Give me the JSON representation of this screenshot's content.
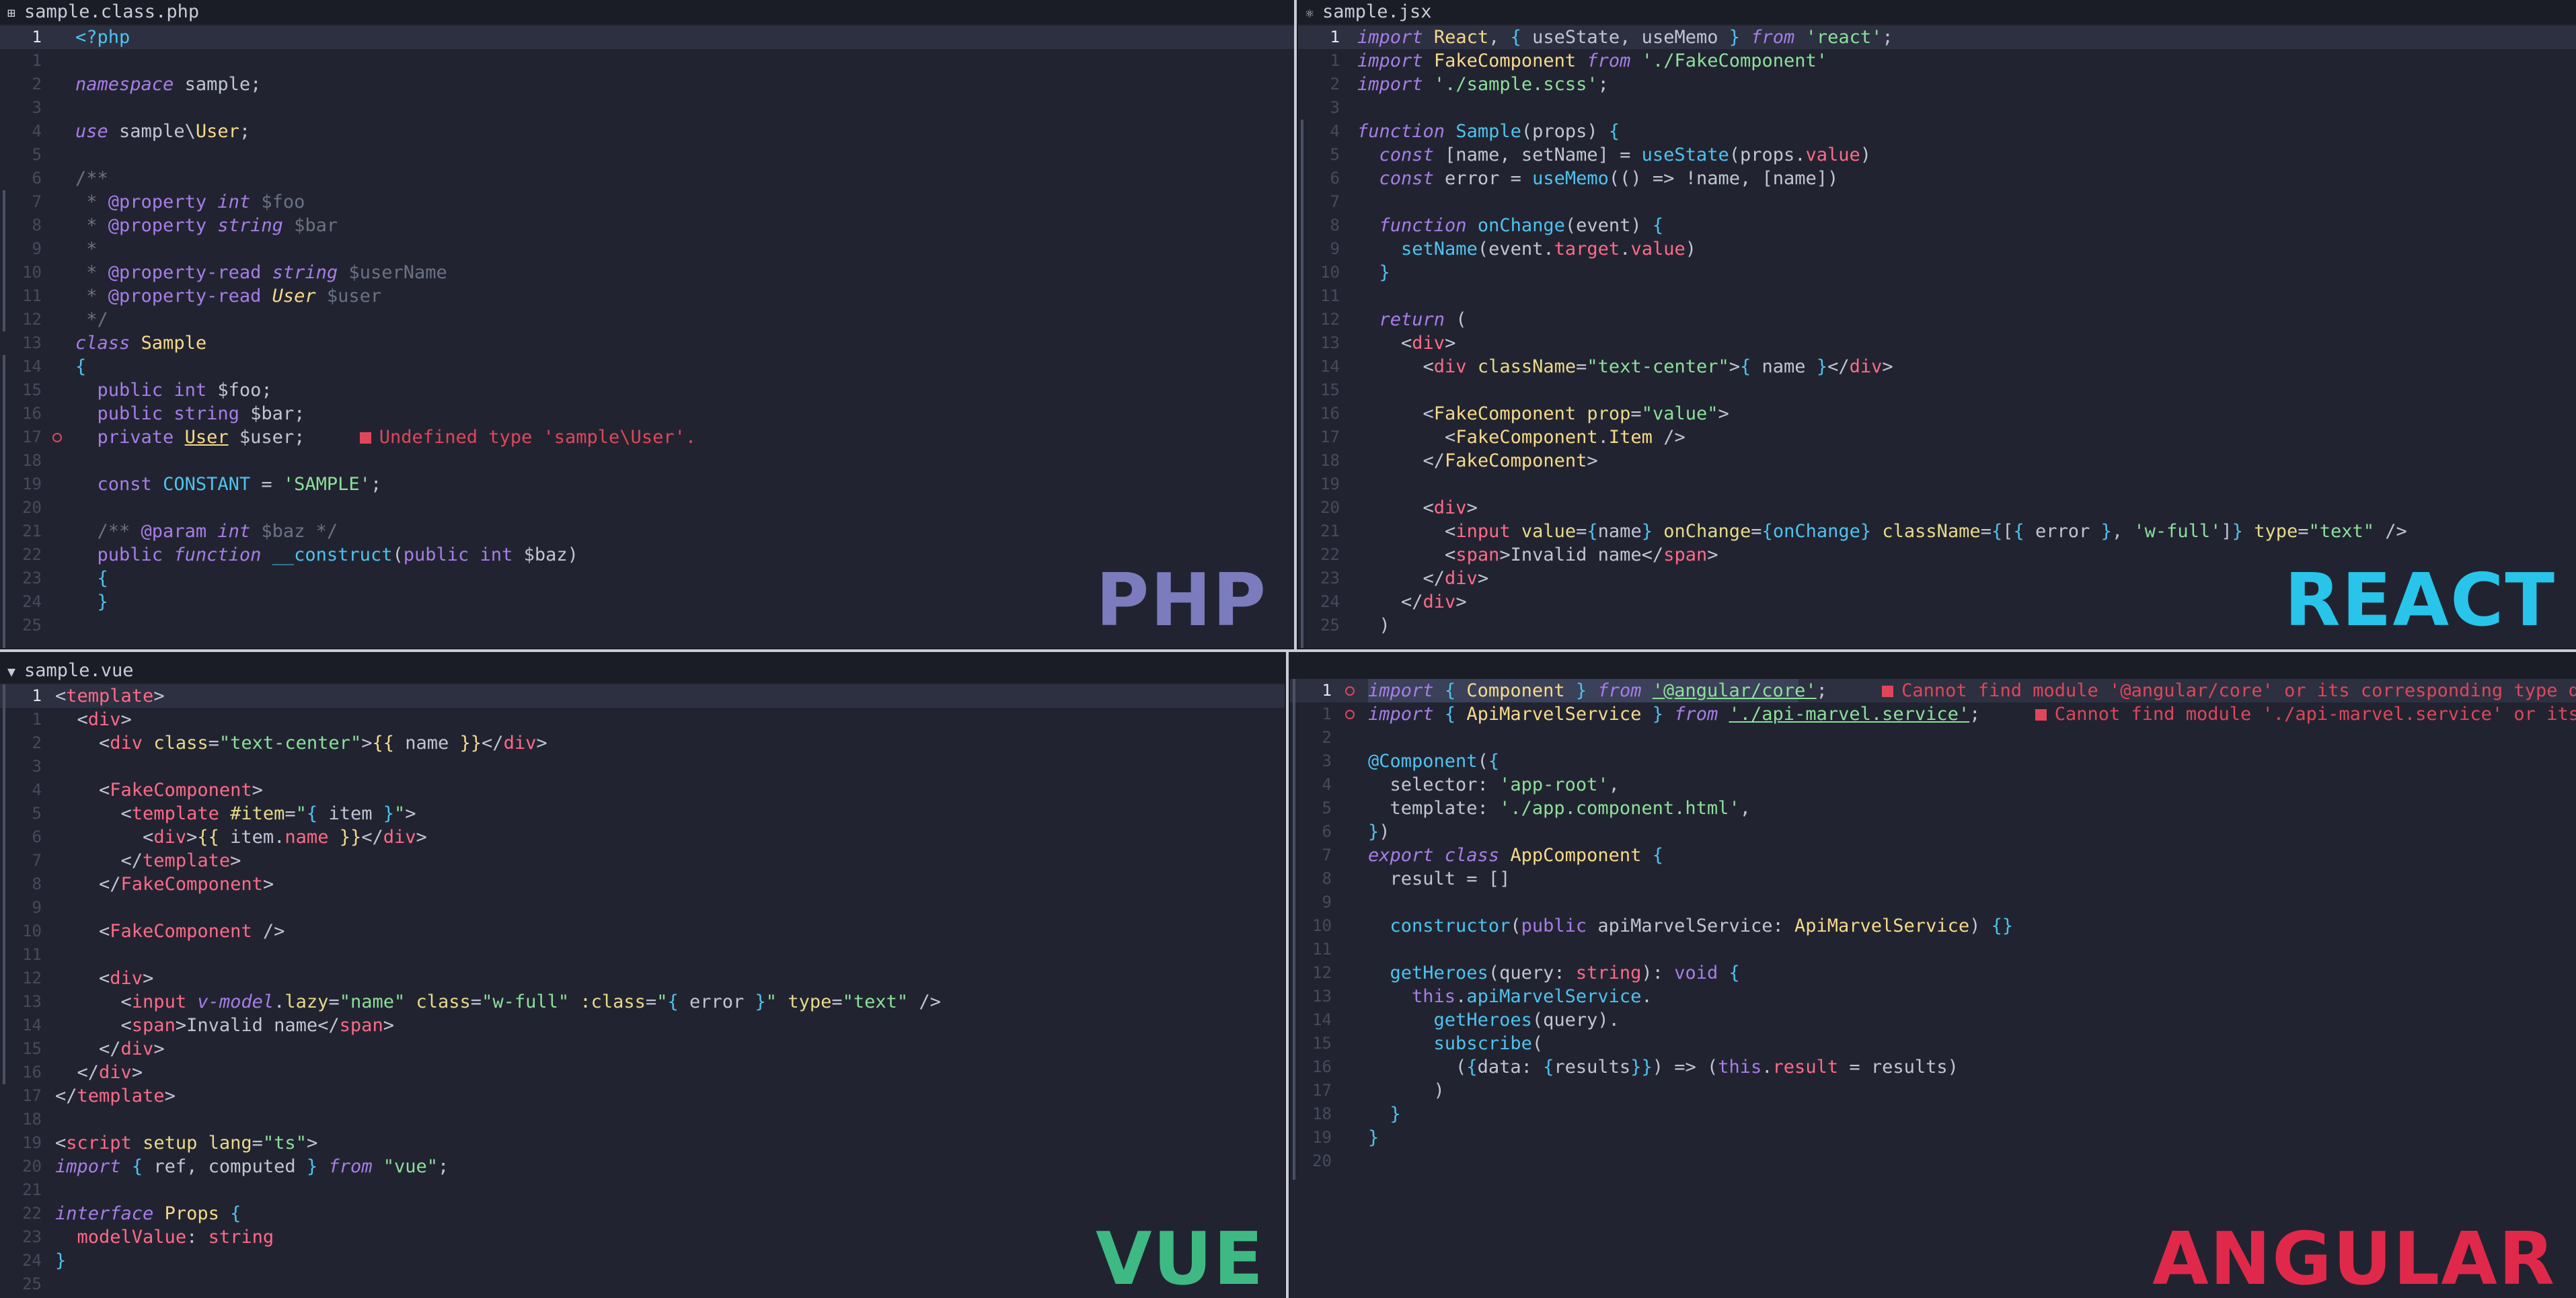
{
  "panes": {
    "php": {
      "tab_title": "sample.class.php",
      "logo": "PHP",
      "logo_color": "#7b7bbd",
      "error_text": "Undefined type 'sample\\User'."
    },
    "react": {
      "tab_title": "sample.jsx",
      "logo": "REACT",
      "logo_color": "#29c4ea"
    },
    "vue": {
      "tab_title": "sample.vue",
      "logo": "VUE",
      "logo_color": "#3fb983"
    },
    "angular": {
      "logo": "ANGULAR",
      "logo_color": "#e0294a",
      "error_1": "Cannot find module '@angular/core' or its corresponding type de",
      "error_2": "Cannot find module './api-marvel.service' or its c"
    }
  },
  "colors": {
    "background": "#1a1c26",
    "editor": "#212430",
    "keyword": "#a87de8",
    "string": "#8ce09a",
    "function": "#4fc2ef",
    "error": "#e0465a"
  }
}
